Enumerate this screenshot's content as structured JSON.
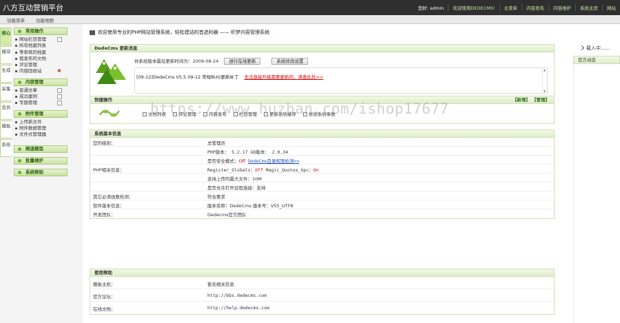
{
  "header": {
    "brand": "八方互动营销平台",
    "user_label": "您好: admin",
    "links": [
      "欢迎使用DEDECMS!",
      "主菜单",
      "内容发布",
      "内容维护",
      "系统主页",
      "网站"
    ]
  },
  "subbar": {
    "items": [
      "功能菜单",
      "功能地图"
    ]
  },
  "leftnav": {
    "tabs": [
      "核心",
      "模块",
      "生成",
      "采集",
      "会员",
      "模板",
      "系统"
    ],
    "groups": [
      {
        "title": "常用操作",
        "items": [
          {
            "label": "网站栏目管理",
            "icon": "page-icon"
          },
          {
            "label": "所有档案列表",
            "icon": ""
          },
          {
            "label": "等审核的档案",
            "icon": ""
          },
          {
            "label": "我发布的文档",
            "icon": ""
          },
          {
            "label": "评论管理",
            "icon": ""
          },
          {
            "label": "内容回收站",
            "icon": "delete-icon"
          }
        ]
      },
      {
        "title": "内容管理",
        "items": [
          {
            "label": "普通文章",
            "icon": "page-icon"
          },
          {
            "label": "成功案例",
            "icon": "page-icon"
          },
          {
            "label": "专题管理",
            "icon": "page-icon"
          }
        ]
      },
      {
        "title": "附件管理",
        "items": [
          {
            "label": "上传新文件",
            "icon": ""
          },
          {
            "label": "附件数据管理",
            "icon": ""
          },
          {
            "label": "文件式管理器",
            "icon": ""
          }
        ]
      },
      {
        "title": "频道模型",
        "items": []
      },
      {
        "title": "批量维护",
        "items": []
      },
      {
        "title": "系统帮助",
        "items": []
      }
    ]
  },
  "main": {
    "welcome": "欢迎使用专业的PHP网站管理系统，轻松建站的首选利器 —— 织梦内容管理系统",
    "update": {
      "title": "DedeCms 更新消息",
      "last_update_label": "你系统版本最后更新时间为：2009-08-24",
      "btn_online": "进行在线更新",
      "btn_modify": "系统修改设置",
      "news_text": "[09-12]DedeCms V5.5 09-12 常规BUG更新补丁",
      "news_link": "无法直接升级需要更新的，请查此处>>"
    },
    "quick": {
      "title": "快捷操作",
      "actions": "【新增】 【管理】",
      "items": [
        "文档列表",
        "评论管理",
        "内容发布",
        "栏目管理",
        "更新系统缓存",
        "修改系统参数"
      ]
    },
    "sysinfo": {
      "title": "系统基本信息",
      "rows": [
        {
          "k": "您的级别：",
          "v": "总管理员"
        },
        {
          "k": "",
          "v": "PHP版本： 5.2.17    GD版本： 2.0.34"
        },
        {
          "k": "",
          "v_prefix": "是否安全模式：",
          "v_red": "Off",
          "v_link": "DedeCms目录权限检测>>"
        },
        {
          "k": "PHP相关信息：",
          "v_prefix": "Register_Globals：",
          "v_red": "Off",
          "v_suffix": "   Magic_Quotes_Gpc：",
          "v_red2": "On"
        },
        {
          "k": "",
          "v": "支持上传的最大文件：10M"
        },
        {
          "k": "",
          "v": "是否允许打开远程连接：支持"
        },
        {
          "k": "其它必须函数检测：",
          "v": "符合要求"
        },
        {
          "k": "软件版本信息：",
          "v": "版本名称：DedeCms    版本号：V55_UTF8"
        },
        {
          "k": "开发团队：",
          "v": "Dedecms官方团队"
        }
      ]
    },
    "help": {
      "title": "使用帮助",
      "rows": [
        {
          "k": "模板主机：",
          "v": "暂无相关信息"
        },
        {
          "k": "官方论坛：",
          "v": "http://bbs.dedecms.com"
        },
        {
          "k": "在线文档：",
          "v": "http://help.dedecms.com"
        }
      ]
    }
  },
  "right": {
    "loading": "载入中......",
    "official": "官方动态"
  },
  "watermark": "https://www.huzhan.com/ishop17677",
  "colors": {
    "accent": "#6fae2a",
    "header_bg": "#2f2f2f",
    "link_red": "#d30000"
  }
}
